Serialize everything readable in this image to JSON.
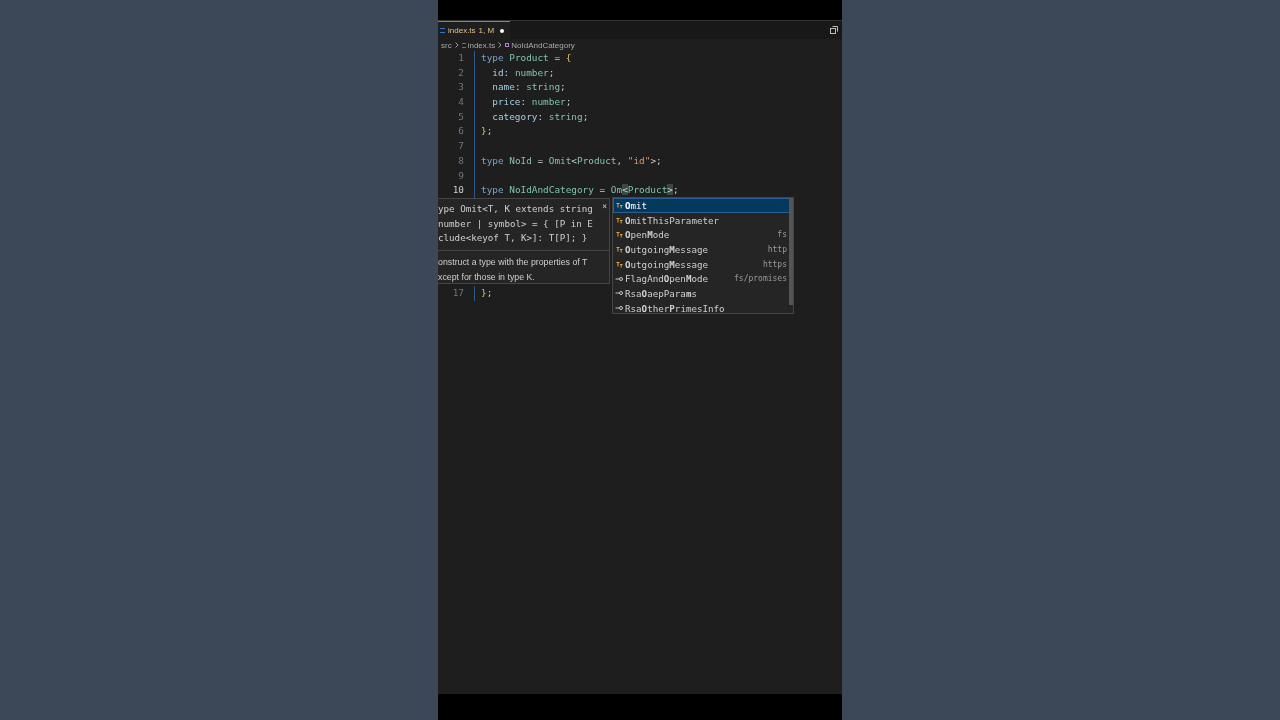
{
  "tab": {
    "label": "index.ts",
    "status": "1, M",
    "modified": true
  },
  "breadcrumb": [
    {
      "text": "src",
      "kind": "folder"
    },
    {
      "text": "index.ts",
      "kind": "file"
    },
    {
      "text": "NoIdAndCategory",
      "kind": "symbol"
    }
  ],
  "code_lines": [
    {
      "number": "1",
      "current": false,
      "tokens": [
        {
          "text": "type ",
          "kind": "keyword"
        },
        {
          "text": "Product",
          "kind": "type"
        },
        {
          "text": " = ",
          "kind": "punct"
        },
        {
          "text": "{",
          "kind": "brace"
        }
      ]
    },
    {
      "number": "2",
      "current": false,
      "tokens": [
        {
          "text": "  id",
          "kind": "prop"
        },
        {
          "text": ": ",
          "kind": "punct"
        },
        {
          "text": "number",
          "kind": "type"
        },
        {
          "text": ";",
          "kind": "punct"
        }
      ]
    },
    {
      "number": "3",
      "current": false,
      "tokens": [
        {
          "text": "  name",
          "kind": "prop"
        },
        {
          "text": ": ",
          "kind": "punct"
        },
        {
          "text": "string",
          "kind": "type"
        },
        {
          "text": ";",
          "kind": "punct"
        }
      ]
    },
    {
      "number": "4",
      "current": false,
      "tokens": [
        {
          "text": "  price",
          "kind": "prop"
        },
        {
          "text": ": ",
          "kind": "punct"
        },
        {
          "text": "number",
          "kind": "type"
        },
        {
          "text": ";",
          "kind": "punct"
        }
      ]
    },
    {
      "number": "5",
      "current": false,
      "tokens": [
        {
          "text": "  category",
          "kind": "prop"
        },
        {
          "text": ": ",
          "kind": "punct"
        },
        {
          "text": "string",
          "kind": "type"
        },
        {
          "text": ";",
          "kind": "punct"
        }
      ]
    },
    {
      "number": "6",
      "current": false,
      "tokens": [
        {
          "text": "}",
          "kind": "brace"
        },
        {
          "text": ";",
          "kind": "punct"
        }
      ]
    },
    {
      "number": "7",
      "current": false
    },
    {
      "number": "8",
      "current": false,
      "tokens": [
        {
          "text": "type ",
          "kind": "keyword"
        },
        {
          "text": "NoId",
          "kind": "type"
        },
        {
          "text": " = ",
          "kind": "punct"
        },
        {
          "text": "Omit",
          "kind": "type"
        },
        {
          "text": "<",
          "kind": "punct"
        },
        {
          "text": "Product",
          "kind": "type"
        },
        {
          "text": ", ",
          "kind": "punct"
        },
        {
          "text": "\"id\"",
          "kind": "string"
        },
        {
          "text": ">;",
          "kind": "punct"
        }
      ]
    },
    {
      "number": "9",
      "current": false
    },
    {
      "number": "10",
      "current": true,
      "tokens": [
        {
          "text": "type ",
          "kind": "keyword"
        },
        {
          "text": "NoIdAndCategory",
          "kind": "type"
        },
        {
          "text": " = ",
          "kind": "punct"
        },
        {
          "text": "Om",
          "kind": "type"
        },
        {
          "text": "<",
          "kind": "match"
        },
        {
          "text": "Product",
          "kind": "type"
        },
        {
          "text": ">",
          "kind": "match"
        },
        {
          "text": ";",
          "kind": "punct"
        }
      ]
    },
    {
      "number": "17",
      "current": false,
      "tokens": [
        {
          "text": "}",
          "kind": "brace"
        },
        {
          "text": ";",
          "kind": "punct"
        }
      ]
    }
  ],
  "hover": {
    "signature": [
      "ype Omit<T, K extends string",
      "number | symbol> = { [P in E",
      "clude<keyof T, K>]: T[P]; }"
    ],
    "close": "×",
    "doc": [
      "onstruct a type with the properties of T",
      "xcept for those in type K."
    ]
  },
  "suggestions": [
    {
      "kind": "type",
      "label": "**O**mit",
      "selected": true
    },
    {
      "kind": "type",
      "label": "**O**mitThisParameter",
      "selected": false
    },
    {
      "kind": "type",
      "label": "**O**pen**M**ode",
      "detail": "fs",
      "selected": false
    },
    {
      "kind": "type",
      "label": "**O**utgoing**M**essage",
      "detail": "http",
      "selected": false
    },
    {
      "kind": "type",
      "label": "**O**utgoing**M**essage",
      "detail": "https",
      "selected": false
    },
    {
      "kind": "alias",
      "label": "FlagAnd**O**pen**M**ode",
      "detail": "fs/promises",
      "selected": false
    },
    {
      "kind": "alias",
      "label": "Rsa**O**aepPara**m**s",
      "selected": false
    },
    {
      "kind": "alias",
      "label": "Rsa**O**ther**P**rimesInfo",
      "selected": false
    }
  ]
}
